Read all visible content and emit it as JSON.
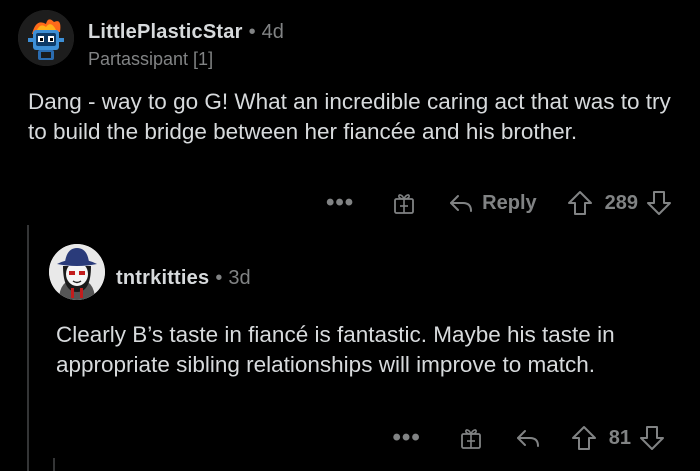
{
  "comment1": {
    "username": "LittlePlasticStar",
    "separator": "•",
    "age": "4d",
    "flair": "Partassipant [1]",
    "text": "Dang - way to go G!  What an incredible caring act that was to try to build the bridge between her fiancée and his brother.",
    "more_label": "•••",
    "reply_label": "Reply",
    "score": "289"
  },
  "comment2": {
    "username": "tntrkitties",
    "separator": "•",
    "age": "3d",
    "text": "Clearly B’s taste in fiancé is fantastic. Maybe his taste in appropriate sibling relationships will improve to match.",
    "more_label": "•••",
    "score": "81"
  },
  "icons": {
    "more": "more-options-icon",
    "gift": "award-gift-icon",
    "reply": "reply-arrow-icon",
    "upvote": "upvote-arrow-icon",
    "downvote": "downvote-arrow-icon"
  },
  "colors": {
    "background": "#000000",
    "text": "#d7dadc",
    "muted": "#818384",
    "thread_line": "#343536"
  }
}
